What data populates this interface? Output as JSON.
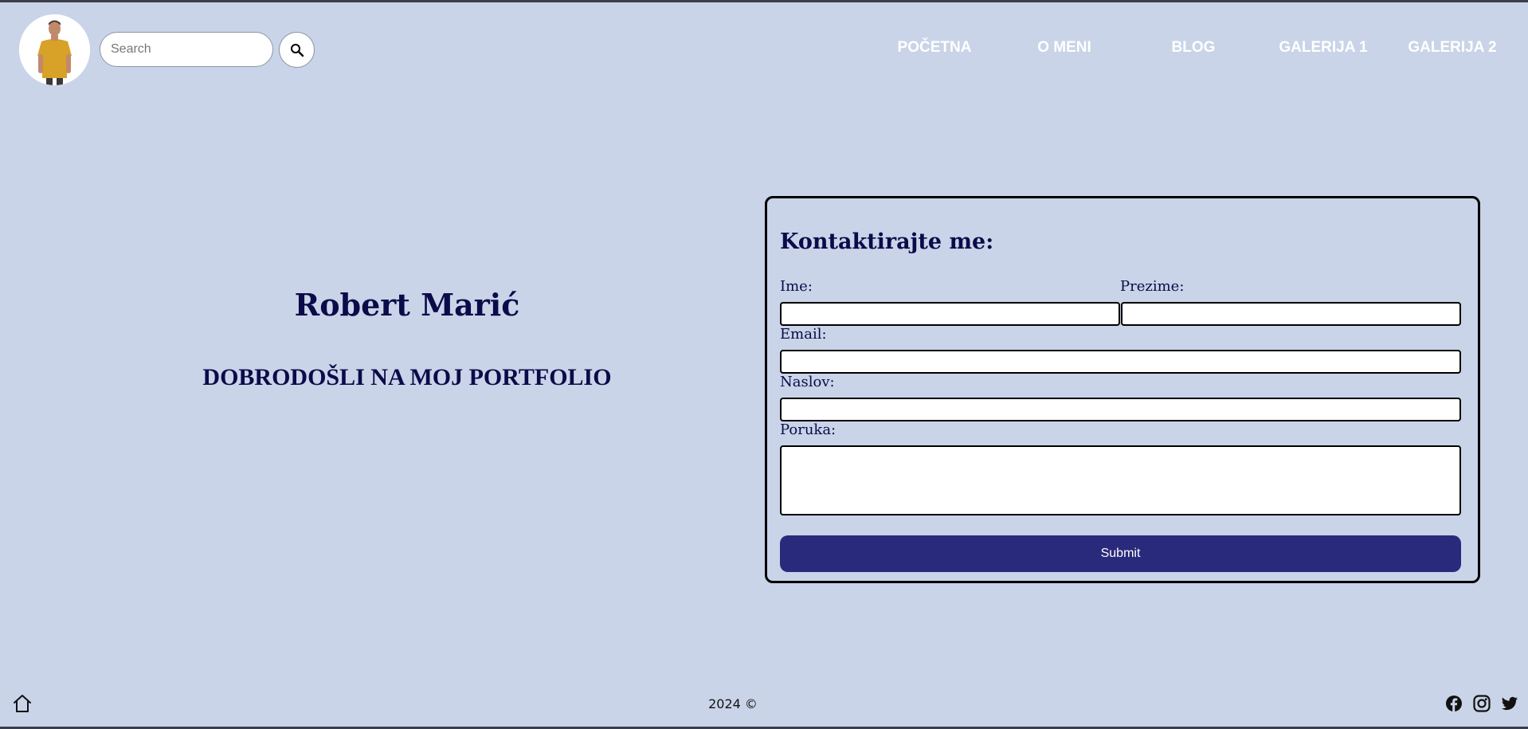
{
  "header": {
    "search_placeholder": "Search",
    "nav": [
      {
        "label": "POČETNA"
      },
      {
        "label": "O MENI"
      },
      {
        "label": "BLOG"
      },
      {
        "label": "GALERIJA 1"
      },
      {
        "label": "GALERIJA 2"
      }
    ]
  },
  "hero": {
    "name": "Robert Marić",
    "subtitle": "DOBRODOŠLI NA MOJ PORTFOLIO"
  },
  "contact": {
    "title": "Kontaktirajte me:",
    "fields": {
      "first_name_label": "Ime:",
      "last_name_label": "Prezime:",
      "email_label": "Email:",
      "subject_label": "Naslov:",
      "message_label": "Poruka:"
    },
    "submit_label": "Submit"
  },
  "footer": {
    "copyright": "2024 ©"
  },
  "icons": {
    "search": "magnifier-icon",
    "home": "home-icon",
    "social": [
      "facebook-icon",
      "instagram-icon",
      "twitter-icon"
    ]
  },
  "colors": {
    "background": "#c9d4e8",
    "heading": "#0b0b4a",
    "nav_text": "#ffffff",
    "submit_bg": "#2a2a7c"
  }
}
